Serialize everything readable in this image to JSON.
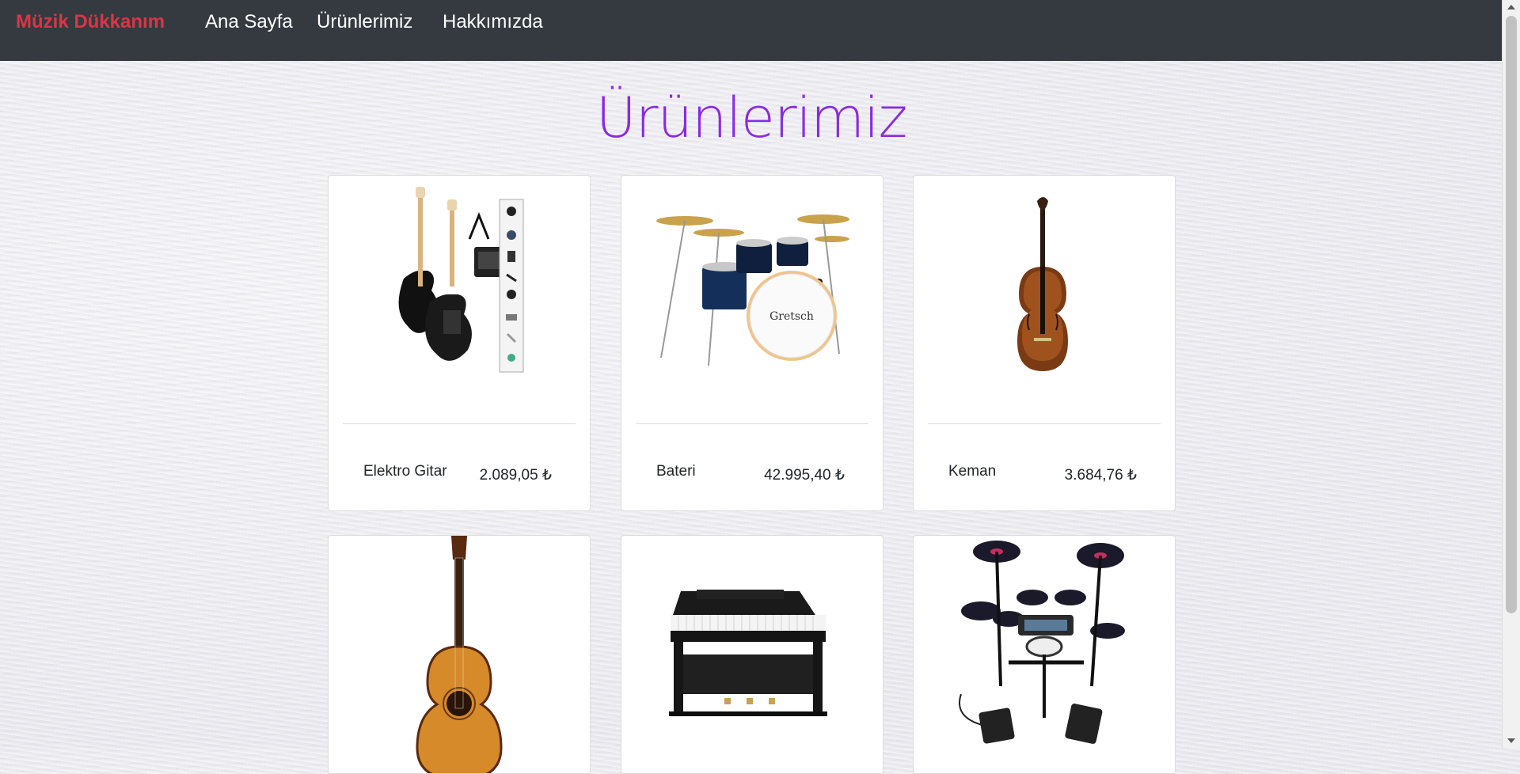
{
  "nav": {
    "brand": "Müzik Dükkanım",
    "links": [
      "Ana Sayfa",
      "Ürünlerimiz",
      "Hakkımızda"
    ]
  },
  "page": {
    "title": "Ürünlerimiz"
  },
  "products": [
    {
      "name": "Elektro Gitar",
      "price": "2.089,05 ₺",
      "icon": "electric-guitar-icon"
    },
    {
      "name": "Bateri",
      "price": "42.995,40 ₺",
      "icon": "drum-kit-icon"
    },
    {
      "name": "Keman",
      "price": "3.684,76 ₺",
      "icon": "violin-icon"
    },
    {
      "icon": "acoustic-guitar-icon"
    },
    {
      "icon": "digital-piano-icon"
    },
    {
      "icon": "electronic-drum-kit-icon"
    }
  ],
  "colors": {
    "navbar": "#343a40",
    "brand": "#dc3545",
    "title": "#8a2be2"
  }
}
